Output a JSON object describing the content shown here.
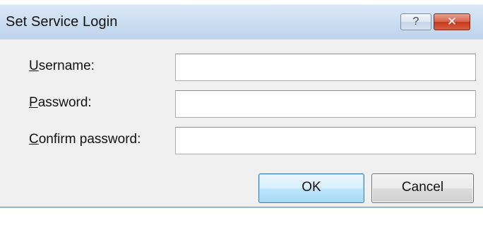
{
  "window": {
    "title": "Set Service Login",
    "help_glyph": "?",
    "close_glyph": "✕"
  },
  "fields": [
    {
      "accel": "U",
      "label_rest": "sername:",
      "value": ""
    },
    {
      "accel": "P",
      "label_rest": "assword:",
      "value": ""
    },
    {
      "accel": "C",
      "label_rest": "onfirm password:",
      "value": ""
    }
  ],
  "buttons": {
    "ok": "OK",
    "cancel": "Cancel"
  },
  "icons": {
    "help": "help-icon",
    "close": "close-icon"
  },
  "colors": {
    "titlebar": "#c9dcf0",
    "close_button": "#c53a20",
    "client_background": "#f0f0f0",
    "default_button_border": "#3c7fb1"
  }
}
